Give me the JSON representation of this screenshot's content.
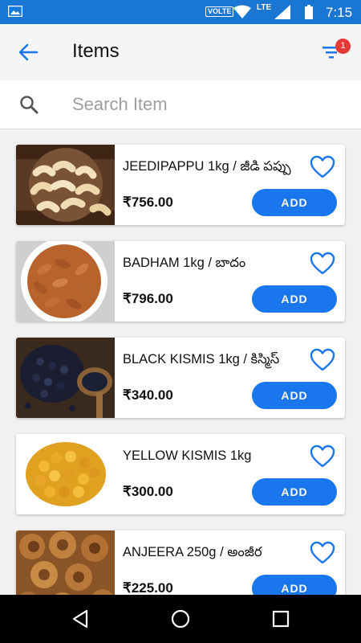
{
  "status_bar": {
    "volte": "VOLTE",
    "network": "LTE",
    "time": "7:15"
  },
  "header": {
    "title": "Items",
    "filter_badge": "1"
  },
  "search": {
    "placeholder": "Search Item"
  },
  "items": [
    {
      "name": "JEEDIPAPPU 1kg / జీడి పప్పు",
      "price": "₹756.00",
      "add_label": "ADD",
      "image": "cashews"
    },
    {
      "name": "BADHAM 1kg / బాదం",
      "price": "₹796.00",
      "add_label": "ADD",
      "image": "almonds"
    },
    {
      "name": "BLACK KISMIS 1kg / కిస్మిస్",
      "price": "₹340.00",
      "add_label": "ADD",
      "image": "black-raisins"
    },
    {
      "name": "YELLOW KISMIS 1kg",
      "price": "₹300.00",
      "add_label": "ADD",
      "image": "yellow-raisins"
    },
    {
      "name": "ANJEERA 250g / అంజీర",
      "price": "₹225.00",
      "add_label": "ADD",
      "image": "figs"
    }
  ],
  "colors": {
    "primary": "#1976d2",
    "button": "#1976ec",
    "badge": "#e53935"
  }
}
